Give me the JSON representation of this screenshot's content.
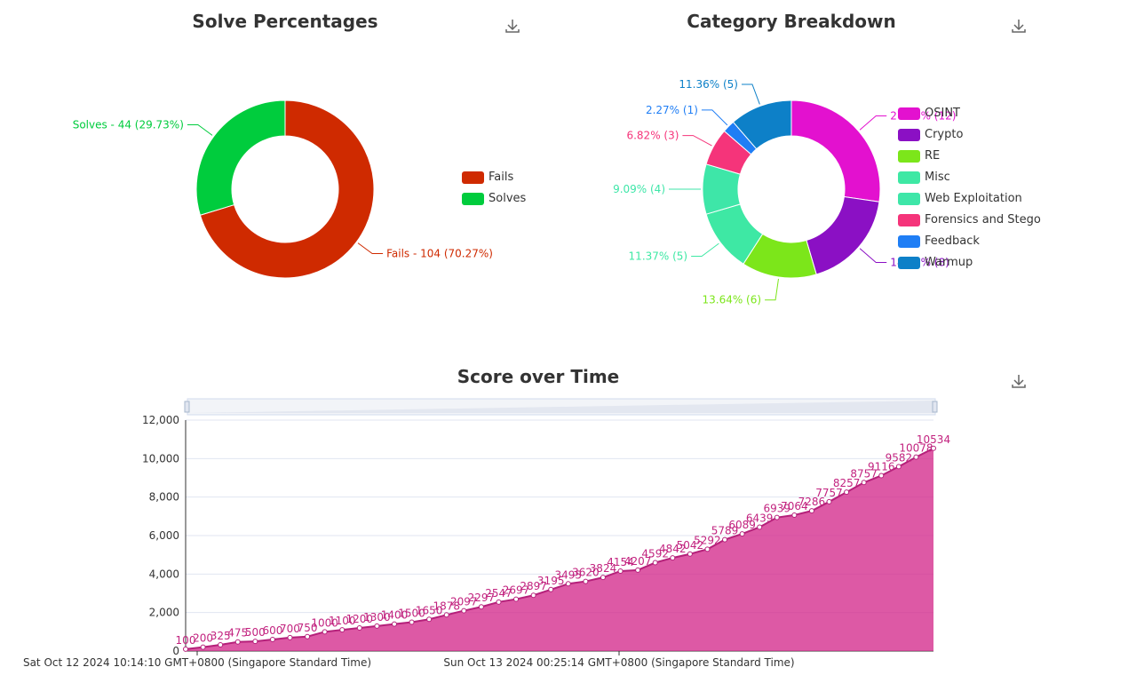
{
  "chart_data": [
    {
      "type": "pie",
      "title": "Solve Percentages",
      "slices": [
        {
          "name": "Fails",
          "value": 104,
          "label": "Fails - 104 (70.27%)",
          "color": "#cf2a00"
        },
        {
          "name": "Solves",
          "value": 44,
          "label": "Solves - 44 (29.73%)",
          "color": "#00cc3d"
        }
      ],
      "legend": [
        "Fails",
        "Solves"
      ],
      "legend_position": "right"
    },
    {
      "type": "pie",
      "title": "Category Breakdown",
      "slices": [
        {
          "name": "OSINT",
          "value": 12,
          "label": "27.27% (12)",
          "color": "#e311cf"
        },
        {
          "name": "Crypto",
          "value": 8,
          "label": "18.18% (8)",
          "color": "#8b10c4"
        },
        {
          "name": "RE",
          "value": 6,
          "label": "13.64% (6)",
          "color": "#7ce61a"
        },
        {
          "name": "Misc",
          "value": 5,
          "label": "11.37% (5)",
          "color": "#3ee8a4"
        },
        {
          "name": "Web Exploitation",
          "value": 4,
          "label": "9.09% (4)",
          "color": "#3ee6a8"
        },
        {
          "name": "Forensics and Stego",
          "value": 3,
          "label": "6.82% (3)",
          "color": "#f5347a"
        },
        {
          "name": "Feedback",
          "value": 1,
          "label": "2.27% (1)",
          "color": "#1f7ef5"
        },
        {
          "name": "Warmup",
          "value": 5,
          "label": "11.36% (5)",
          "color": "#0d80c8"
        }
      ],
      "legend": [
        "OSINT",
        "Crypto",
        "RE",
        "Misc",
        "Web Exploitation",
        "Forensics and Stego",
        "Feedback",
        "Warmup"
      ],
      "legend_position": "right"
    },
    {
      "type": "area",
      "title": "Score over Time",
      "color": "#d5308f",
      "ylim": [
        0,
        12000
      ],
      "yticks": [
        "0",
        "2,000",
        "4,000",
        "6,000",
        "8,000",
        "10,000",
        "12,000"
      ],
      "xtick_labels": [
        "Sat Oct 12 2024 10:14:10 GMT+0800 (Singapore Standard Time)",
        "Sun Oct 13 2024 00:25:14 GMT+0800 (Singapore Standard Time)"
      ],
      "values": [
        100,
        200,
        325,
        475,
        500,
        600,
        700,
        750,
        1000,
        1100,
        1200,
        1300,
        1400,
        1500,
        1650,
        1878,
        2097,
        2297,
        2547,
        2697,
        2897,
        3195,
        3495,
        3620,
        3824,
        4154,
        4207,
        4592,
        4842,
        5042,
        5292,
        5789,
        6089,
        6439,
        6939,
        7064,
        7286,
        7757,
        8257,
        8757,
        9116,
        9582,
        10078,
        10534
      ],
      "grid": true
    }
  ]
}
